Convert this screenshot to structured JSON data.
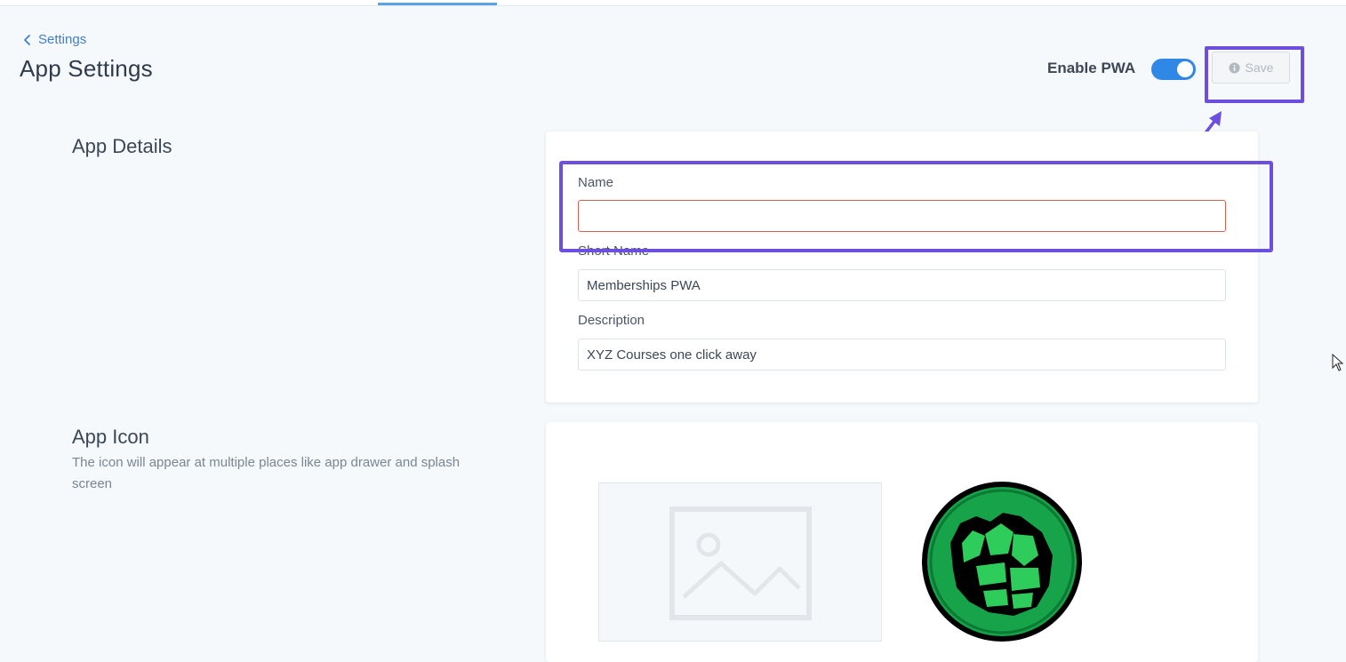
{
  "breadcrumb": {
    "back_label": "Settings"
  },
  "page": {
    "title": "App Settings"
  },
  "header": {
    "pwa_label": "Enable PWA",
    "pwa_enabled": true,
    "save_label": "Save",
    "save_disabled": true
  },
  "sections": {
    "details": {
      "title": "App Details",
      "fields": [
        {
          "label": "Name",
          "value": "",
          "error": true
        },
        {
          "label": "Short Name",
          "value": "Memberships PWA"
        },
        {
          "label": "Description",
          "value": "XYZ Courses one click away"
        }
      ]
    },
    "icon": {
      "title": "App Icon",
      "description": "The icon will appear at multiple places like app drawer and splash screen"
    }
  },
  "icons": {
    "back": "chevron-left-icon",
    "save": "info-circle-icon",
    "placeholder": "image-placeholder-icon",
    "app_icon": "green-fist-logo"
  },
  "colors": {
    "accent": "#2f88e6",
    "link": "#3f7fcf",
    "highlight": "#6d4fe0",
    "error_border": "#d9604c",
    "background": "#f6f9fc"
  }
}
